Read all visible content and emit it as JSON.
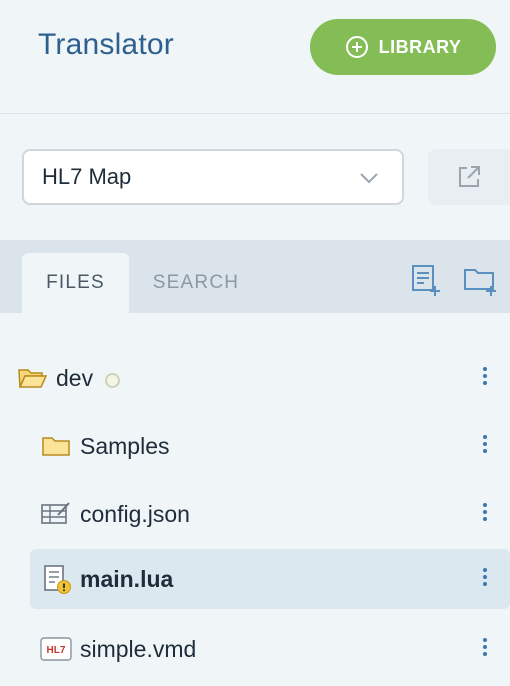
{
  "header": {
    "title": "Translator",
    "library_button": "LIBRARY"
  },
  "selector": {
    "value": "HL7 Map"
  },
  "tabs": [
    {
      "label": "FILES",
      "active": true
    },
    {
      "label": "SEARCH",
      "active": false
    }
  ],
  "tree": [
    {
      "label": "dev",
      "icon": "open-folder-icon",
      "status": "idle"
    },
    {
      "label": "Samples",
      "icon": "folder-icon"
    },
    {
      "label": "config.json",
      "icon": "table-edit-icon"
    },
    {
      "label": "main.lua",
      "icon": "file-warning-icon",
      "selected": true
    },
    {
      "label": "simple.vmd",
      "icon": "hl7-file-icon",
      "badge": "HL7"
    }
  ],
  "colors": {
    "accent": "#84bd55",
    "title": "#2d5f8f",
    "selected_row": "#dce8f0"
  }
}
